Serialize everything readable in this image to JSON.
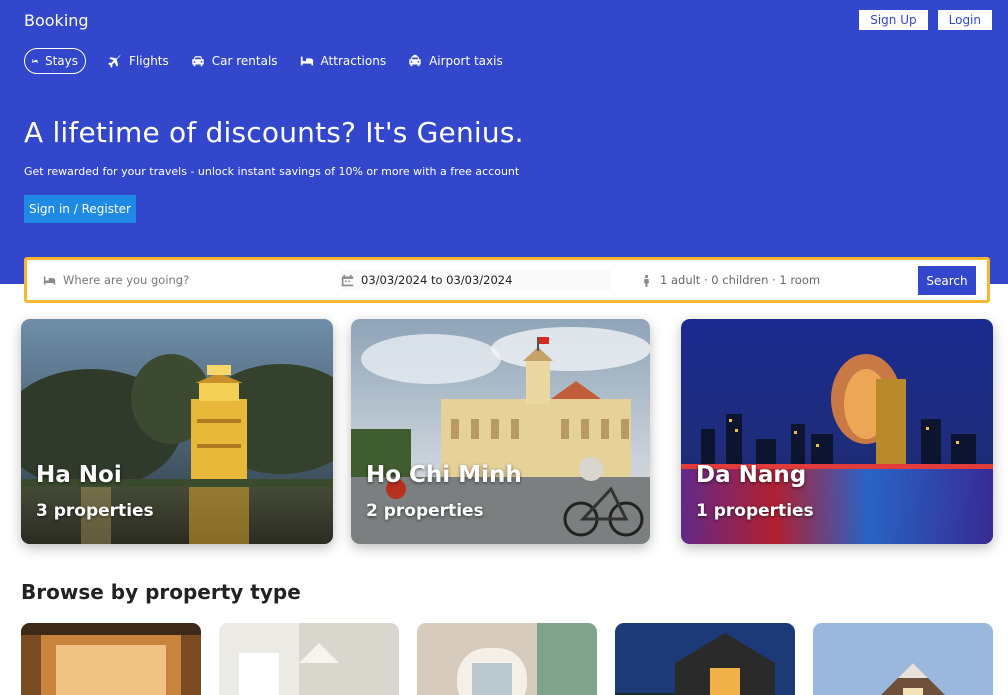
{
  "header": {
    "brand": "Booking",
    "auth": {
      "signup_label": "Sign Up",
      "login_label": "Login"
    },
    "nav": [
      {
        "label": "Stays",
        "icon": "bed-icon",
        "active": true
      },
      {
        "label": "Flights",
        "icon": "plane-icon",
        "active": false
      },
      {
        "label": "Car rentals",
        "icon": "car-icon",
        "active": false
      },
      {
        "label": "Attractions",
        "icon": "bed-icon",
        "active": false
      },
      {
        "label": "Airport taxis",
        "icon": "taxi-icon",
        "active": false
      }
    ],
    "hero": {
      "title": "A lifetime of discounts? It's Genius.",
      "subtitle": "Get rewarded for your travels - unlock instant savings of 10% or more with a free account",
      "cta_label": "Sign in / Register"
    }
  },
  "search": {
    "destination_placeholder": "Where are you going?",
    "dates": "03/03/2024 to 03/03/2024",
    "guests": "1 adult · 0 children · 1 room",
    "button_label": "Search"
  },
  "cities": [
    {
      "name": "Ha Noi",
      "properties": "3 properties"
    },
    {
      "name": "Ho Chi Minh",
      "properties": "2 properties"
    },
    {
      "name": "Da Nang",
      "properties": "1 properties"
    }
  ],
  "browse": {
    "title": "Browse by property type"
  },
  "colors": {
    "brand_blue": "#3347cc",
    "accent_button": "#1e8ae6",
    "search_border": "#f6b731"
  }
}
